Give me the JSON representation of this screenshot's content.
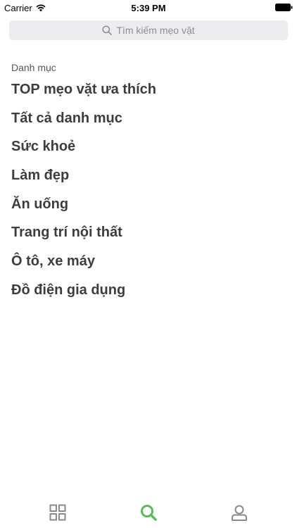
{
  "status_bar": {
    "carrier": "Carrier",
    "time": "5:39 PM",
    "wifi_icon": "wifi-icon",
    "battery_icon": "battery-icon"
  },
  "search": {
    "placeholder": "Tìm kiếm mẹo vặt",
    "icon": "search-icon"
  },
  "categories": {
    "header": "Danh mục",
    "items": [
      "TOP mẹo vặt ưa thích",
      "Tất cả danh mục",
      "Sức khoẻ",
      "Làm đẹp",
      "Ăn uống",
      "Trang trí nội thất",
      "Ô tô, xe máy",
      "Đồ điện gia dụng"
    ]
  },
  "tab_bar": {
    "tabs": [
      {
        "icon": "grid-icon",
        "active": false
      },
      {
        "icon": "search-icon",
        "active": true
      },
      {
        "icon": "user-icon",
        "active": false
      }
    ],
    "active_color": "#5cb85c",
    "inactive_color": "#8a8a8a"
  }
}
